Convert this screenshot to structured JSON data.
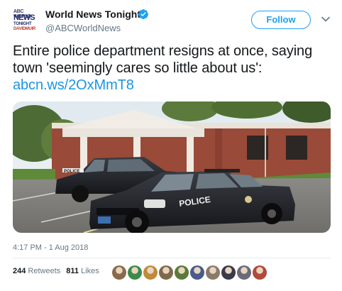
{
  "account": {
    "name": "World News Tonight",
    "handle": "@ABCWorldNews",
    "logo_lines": [
      "ABC WORLD",
      "NEWS",
      "TONIGHT",
      "DAVIDMUIR"
    ]
  },
  "follow_label": "Follow",
  "tweet": {
    "text": "Entire police department resigns at once, saying town 'seemingly cares so little about us': ",
    "link": "abcn.ws/2OxMmT8"
  },
  "photo": {
    "car_labels": [
      "POLICE",
      "POLICE"
    ]
  },
  "timestamp": "4:17 PM - 1 Aug 2018",
  "stats": {
    "retweets_count": "244",
    "retweets_label": "Retweets",
    "likes_count": "811",
    "likes_label": "Likes"
  },
  "likers": [
    {
      "color": "#8a6a4a"
    },
    {
      "color": "#3b8a4a"
    },
    {
      "color": "#c08a3a"
    },
    {
      "color": "#7d6a4a"
    },
    {
      "color": "#5a7a3a"
    },
    {
      "color": "#4a5a8a"
    },
    {
      "color": "#8a7a6a"
    },
    {
      "color": "#3a3a4a"
    },
    {
      "color": "#6a6a7a"
    },
    {
      "color": "#b04a3a"
    },
    {
      "color": "#9a8a7a"
    }
  ],
  "colors": {
    "accent": "#1da1f2",
    "link": "#1b95e0",
    "muted": "#657786"
  }
}
